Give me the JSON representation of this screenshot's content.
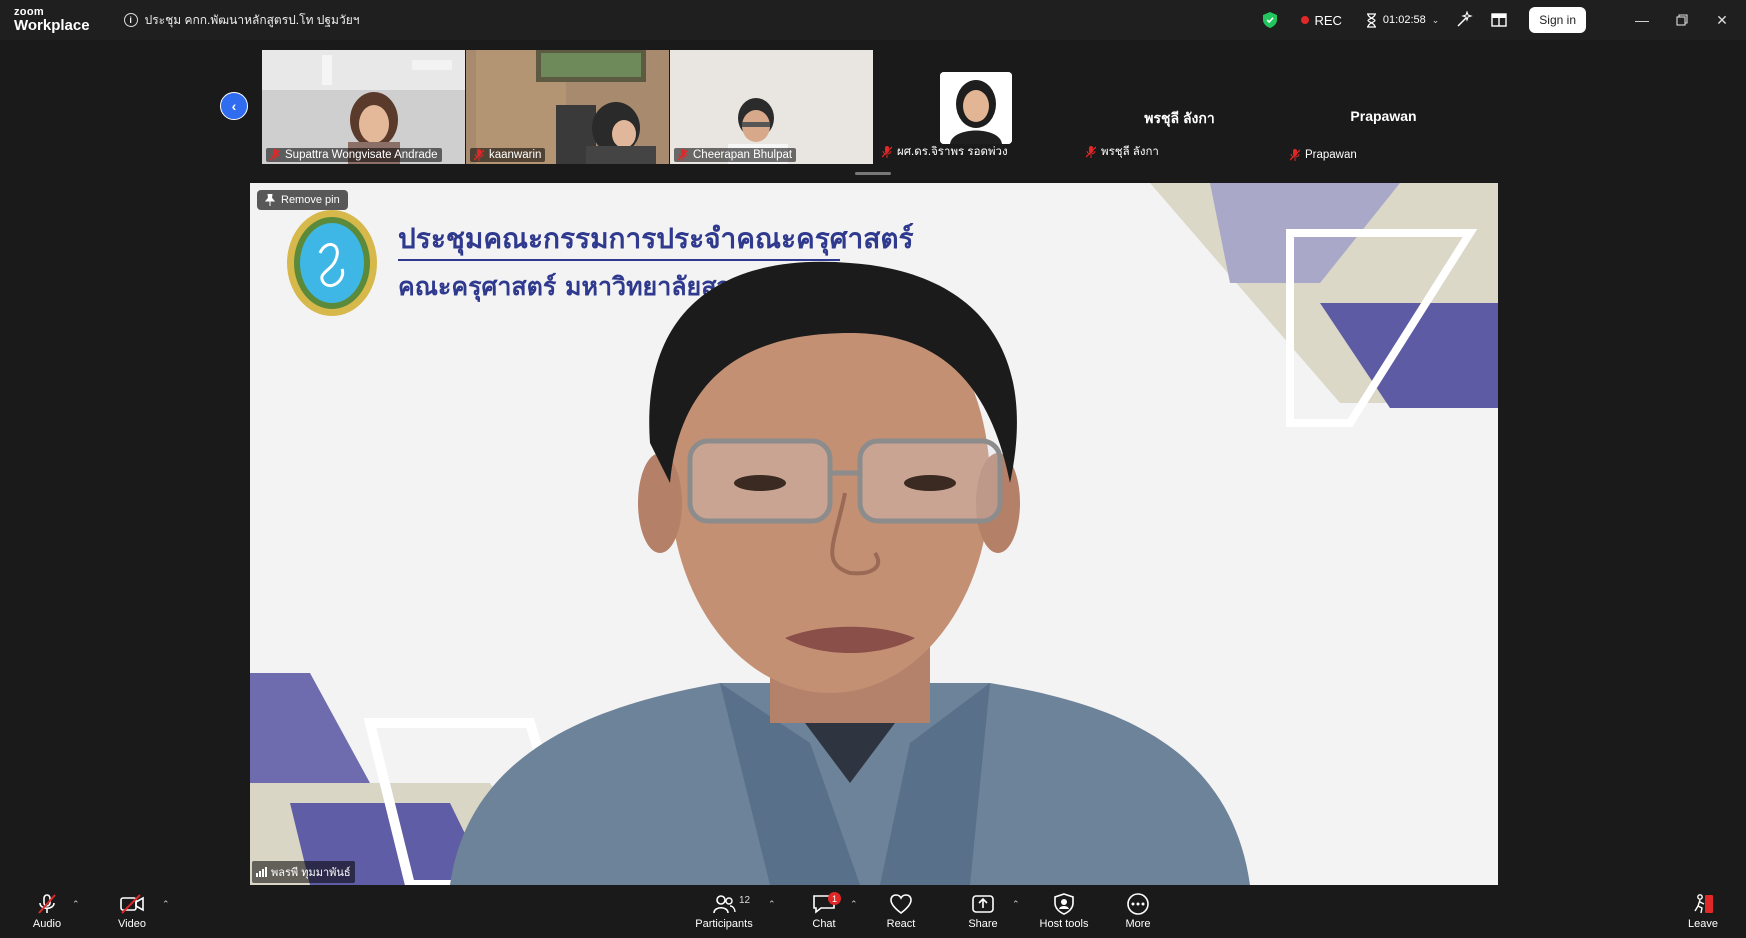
{
  "app": {
    "logo_small": "zoom",
    "logo_big": "Workplace",
    "meeting_title": "ประชุม คกก.พัฒนาหลักสูตรป.โท ปฐมวัยฯ"
  },
  "titlebar": {
    "rec_label": "REC",
    "timer": "01:02:58",
    "sign_in": "Sign in",
    "colors": {
      "rec": "#e02828",
      "shield": "#22c55e"
    }
  },
  "participants_strip": [
    {
      "name": "Supattra Wongvisate Andrade",
      "muted": true
    },
    {
      "name": "kaanwarin",
      "muted": true
    },
    {
      "name": "Cheerapan Bhulpat",
      "muted": true
    },
    {
      "name": "ผศ.ดร.จิราพร รอดพ่วง",
      "muted": true
    },
    {
      "display": "พรชุลี ลังกา",
      "name": "พรชุลี ลังกา",
      "muted": true
    },
    {
      "display": "Prapawan",
      "name": "Prapawan",
      "muted": true
    }
  ],
  "main": {
    "remove_pin": "Remove pin",
    "slide_title": "ประชุมคณะกรรมการประจำคณะครุศาสตร์",
    "slide_subtitle": "คณะครุศาสตร์ มหาวิทยาลัยสวนดุสิต",
    "speaker_name": "พลรพี ทุมมาพันธ์",
    "accent": "#2f3a8f"
  },
  "toolbar": {
    "audio": "Audio",
    "video": "Video",
    "participants": "Participants",
    "participants_count": "12",
    "chat": "Chat",
    "chat_badge": "1",
    "react": "React",
    "share": "Share",
    "host_tools": "Host tools",
    "more": "More",
    "leave": "Leave",
    "colors": {
      "muted": "#e02828",
      "share": "#ffffff"
    }
  }
}
